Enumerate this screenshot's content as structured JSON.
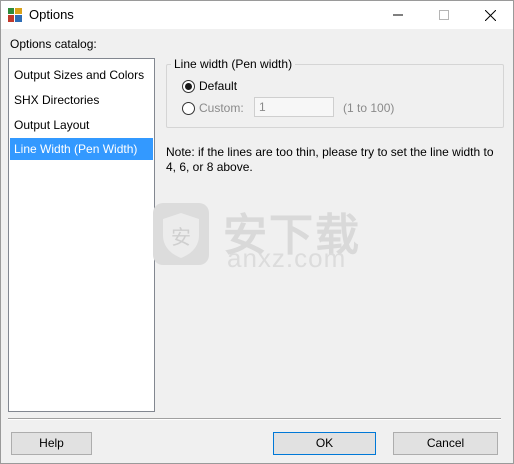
{
  "window": {
    "title": "Options"
  },
  "catalog": {
    "label": "Options catalog:",
    "items": [
      {
        "label": "Output Sizes and Colors",
        "selected": false
      },
      {
        "label": "SHX Directories",
        "selected": false
      },
      {
        "label": "Output Layout",
        "selected": false
      },
      {
        "label": "Line Width (Pen Width)",
        "selected": true
      }
    ]
  },
  "line_width": {
    "group_title": "Line width (Pen width)",
    "default_label": "Default",
    "default_selected": true,
    "custom_label": "Custom:",
    "custom_value": "1",
    "range_hint": "(1 to 100)"
  },
  "note": "Note: if the lines are too thin, please try to set the line width to 4, 6, or 8 above.",
  "watermark": {
    "logo_text": "安",
    "cn_text": "安下载",
    "en_text": "anxz.com"
  },
  "buttons": {
    "help": "Help",
    "ok": "OK",
    "cancel": "Cancel"
  },
  "colors": {
    "selection": "#3399ff",
    "button_face": "#e1e1e1",
    "default_button_border": "#0078d7"
  }
}
